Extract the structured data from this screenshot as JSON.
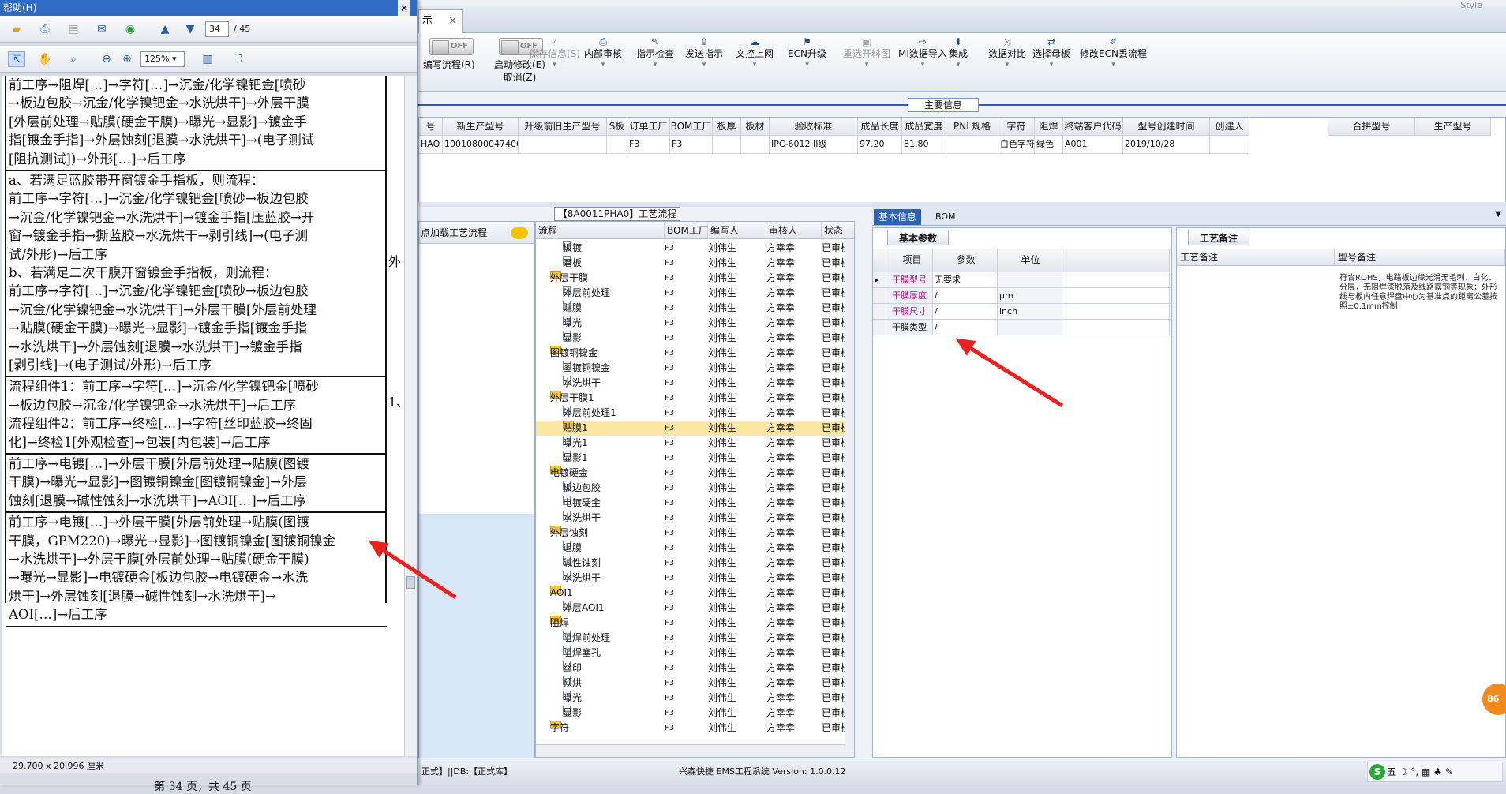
{
  "pdf": {
    "title": "帮助(H)",
    "close": "×",
    "page_current": "34",
    "page_total": "/ 45",
    "zoom": "125%",
    "size": "29.700 x 20.996 厘米",
    "footer": "第 34 页，共 45 页",
    "cells": [
      {
        "lines": [
          "前工序→阻焊[…]→字符[…]→沉金/化学镍钯金[喷砂",
          "→板边包胶→沉金/化学镍钯金→水洗烘干]→外层干膜",
          "[外层前处理→贴膜(硬金干膜)→曝光→显影]→镀金手",
          "指[镀金手指]→外层蚀刻[退膜→水洗烘干]→(电子测试",
          "[阻抗测试])→外形[…]→后工序"
        ]
      },
      {
        "lines": [
          "a、若满足蓝胶带开窗镀金手指板，则流程：",
          "前工序→字符[…]→沉金/化学镍钯金[喷砂→板边包胶",
          "→沉金/化学镍钯金→水洗烘干]→镀金手指[压蓝胶→开",
          "窗→镀金手指→撕蓝胶→水洗烘干→剥引线]→(电子测",
          "试/外形)→后工序",
          "b、若满足二次干膜开窗镀金手指板，则流程：",
          "前工序→字符[…]→沉金/化学镍钯金[喷砂→板边包胶",
          "→沉金/化学镍钯金→水洗烘干]→外层干膜[外层前处理",
          "→贴膜(硬金干膜)→曝光→显影]→镀金手指[镀金手指",
          "→水洗烘干]→外层蚀刻[退膜→水洗烘干]→镀金手指",
          "[剥引线]→(电子测试/外形)→后工序"
        ]
      },
      {
        "lines": [
          "流程组件1：前工序→字符[…]→沉金/化学镍钯金[喷砂",
          "→板边包胶→沉金/化学镍钯金→水洗烘干]→后工序",
          "流程组件2：前工序→终检[…]→字符[丝印蓝胶→终固",
          "化]→终检1[外观检查]→包装[内包装]→后工序"
        ]
      },
      {
        "lines": [
          "前工序→电镀[…]→外层干膜[外层前处理→贴膜(图镀",
          "干膜)→曝光→显影]→图镀铜镍金[图镀铜镍金]→外层",
          "蚀刻[退膜→碱性蚀刻→水洗烘干]→AOI[…]→后工序"
        ]
      },
      {
        "lines": [
          "前工序→电镀[…]→外层干膜[外层前处理→贴膜(图镀",
          "干膜，GPM220)→曝光→显影]→图镀铜镍金[图镀铜镍金",
          "→水洗烘干]→外层干膜[外层前处理→贴膜(硬金干膜)",
          "→曝光→显影]→电镀硬金[板边包胶→电镀硬金→水洗",
          "烘干]→外层蚀刻[退膜→碱性蚀刻→水洗烘干]→",
          "AOI[…]→后工序"
        ]
      }
    ],
    "side_marks": [
      "外",
      "1、"
    ]
  },
  "app": {
    "tab_label": "示",
    "tab_close": "×",
    "style_label": "Style",
    "toggles": [
      {
        "state": "OFF",
        "label": "编写流程(R)"
      },
      {
        "state": "OFF",
        "label": "启动修改(E)",
        "label2": "取消(Z)"
      }
    ],
    "ribbon": [
      {
        "icon": "✓",
        "label": "保存信息(S)",
        "disabled": true
      },
      {
        "icon": "⎙",
        "label": "内部审核"
      },
      {
        "icon": "✎",
        "label": "指示检查"
      },
      {
        "icon": "⇪",
        "label": "发送指示"
      },
      {
        "icon": "☁",
        "label": "文控上网"
      },
      {
        "icon": "⚑",
        "label": "ECN升级"
      },
      {
        "icon": "▣",
        "label": "重选开料图",
        "disabled": true
      },
      {
        "icon": "⇨",
        "label": "MI数据导入"
      },
      {
        "icon": "⬇",
        "label": "集成"
      },
      {
        "icon": "⤨",
        "label": "数据对比"
      },
      {
        "icon": "⇄",
        "label": "选择母板"
      },
      {
        "icon": "✐",
        "label": "修改ECN丢流程"
      }
    ],
    "section_title": "主要信息",
    "main_headers": [
      "号",
      "新生产型号",
      "升级前旧生产型号",
      "S板",
      "订单工厂",
      "BOM工厂",
      "板厚",
      "板材",
      "验收标准",
      "成品长度",
      "成品宽度",
      "PNL规格",
      "字符",
      "阻焊",
      "终端客户代码",
      "型号创建时间",
      "创建人"
    ],
    "main_row": [
      "HAO",
      "10010800047406",
      "",
      "",
      "F3",
      "F3",
      "",
      "",
      "IPC-6012 II级",
      "97.20",
      "81.80",
      "",
      "白色字符",
      "绿色",
      "A001",
      "2019/10/28",
      ""
    ],
    "side_headers": [
      "合拼型号",
      "生产型号"
    ],
    "flow_title": "【8A0011PHA0】工艺流程",
    "left_header": "点加载工艺流程",
    "flow_headers": [
      "流程",
      "BOM工厂",
      "编写人",
      "审核人",
      "状态"
    ],
    "flow_rows": [
      {
        "level": 2,
        "type": "doc",
        "name": "板镀",
        "bom": "F3",
        "editor": "刘伟生",
        "reviewer": "方幸幸",
        "status": "已审核"
      },
      {
        "level": 2,
        "type": "doc",
        "name": "磨板",
        "bom": "F3",
        "editor": "刘伟生",
        "reviewer": "方幸幸",
        "status": "已审核"
      },
      {
        "level": 1,
        "type": "folder",
        "name": "外层干膜",
        "bom": "F3",
        "editor": "刘伟生",
        "reviewer": "方幸幸",
        "status": "已审核"
      },
      {
        "level": 2,
        "type": "doc",
        "name": "外层前处理",
        "bom": "F3",
        "editor": "刘伟生",
        "reviewer": "方幸幸",
        "status": "已审核"
      },
      {
        "level": 2,
        "type": "doc",
        "name": "贴膜",
        "bom": "F3",
        "editor": "刘伟生",
        "reviewer": "方幸幸",
        "status": "已审核"
      },
      {
        "level": 2,
        "type": "doc",
        "name": "曝光",
        "bom": "F3",
        "editor": "刘伟生",
        "reviewer": "方幸幸",
        "status": "已审核"
      },
      {
        "level": 2,
        "type": "doc",
        "name": "显影",
        "bom": "F3",
        "editor": "刘伟生",
        "reviewer": "方幸幸",
        "status": "已审核"
      },
      {
        "level": 1,
        "type": "folder",
        "name": "图镀铜镍金",
        "bom": "F3",
        "editor": "刘伟生",
        "reviewer": "方幸幸",
        "status": "已审核"
      },
      {
        "level": 2,
        "type": "doc",
        "name": "图镀铜镍金",
        "bom": "F3",
        "editor": "刘伟生",
        "reviewer": "方幸幸",
        "status": "已审核"
      },
      {
        "level": 2,
        "type": "doc",
        "name": "水洗烘干",
        "bom": "F3",
        "editor": "刘伟生",
        "reviewer": "方幸幸",
        "status": "已审核"
      },
      {
        "level": 1,
        "type": "folder",
        "name": "外层干膜1",
        "bom": "F3",
        "editor": "刘伟生",
        "reviewer": "方幸幸",
        "status": "已审核"
      },
      {
        "level": 2,
        "type": "doc",
        "name": "外层前处理1",
        "bom": "F3",
        "editor": "刘伟生",
        "reviewer": "方幸幸",
        "status": "已审核"
      },
      {
        "level": 2,
        "type": "folder",
        "name": "贴膜1",
        "bom": "F3",
        "editor": "刘伟生",
        "reviewer": "方幸幸",
        "status": "已审核",
        "selected": true
      },
      {
        "level": 2,
        "type": "doc",
        "name": "曝光1",
        "bom": "F3",
        "editor": "刘伟生",
        "reviewer": "方幸幸",
        "status": "已审核"
      },
      {
        "level": 2,
        "type": "doc",
        "name": "显影1",
        "bom": "F3",
        "editor": "刘伟生",
        "reviewer": "方幸幸",
        "status": "已审核"
      },
      {
        "level": 1,
        "type": "folder",
        "name": "电镀硬金",
        "bom": "F3",
        "editor": "刘伟生",
        "reviewer": "方幸幸",
        "status": "已审核"
      },
      {
        "level": 2,
        "type": "doc",
        "name": "板边包胶",
        "bom": "F3",
        "editor": "刘伟生",
        "reviewer": "方幸幸",
        "status": "已审核"
      },
      {
        "level": 2,
        "type": "doc",
        "name": "电镀硬金",
        "bom": "F3",
        "editor": "刘伟生",
        "reviewer": "方幸幸",
        "status": "已审核"
      },
      {
        "level": 2,
        "type": "doc",
        "name": "水洗烘干",
        "bom": "F3",
        "editor": "刘伟生",
        "reviewer": "方幸幸",
        "status": "已审核"
      },
      {
        "level": 1,
        "type": "folder",
        "name": "外层蚀刻",
        "bom": "F3",
        "editor": "刘伟生",
        "reviewer": "方幸幸",
        "status": "已审核"
      },
      {
        "level": 2,
        "type": "doc",
        "name": "退膜",
        "bom": "F3",
        "editor": "刘伟生",
        "reviewer": "方幸幸",
        "status": "已审核"
      },
      {
        "level": 2,
        "type": "doc",
        "name": "碱性蚀刻",
        "bom": "F3",
        "editor": "刘伟生",
        "reviewer": "方幸幸",
        "status": "已审核"
      },
      {
        "level": 2,
        "type": "doc",
        "name": "水洗烘干",
        "bom": "F3",
        "editor": "刘伟生",
        "reviewer": "方幸幸",
        "status": "已审核"
      },
      {
        "level": 1,
        "type": "folder",
        "name": "AOI1",
        "bom": "F3",
        "editor": "刘伟生",
        "reviewer": "方幸幸",
        "status": "已审核"
      },
      {
        "level": 2,
        "type": "doc",
        "name": "外层AOI1",
        "bom": "F3",
        "editor": "刘伟生",
        "reviewer": "方幸幸",
        "status": "已审核"
      },
      {
        "level": 1,
        "type": "folder",
        "name": "阻焊",
        "bom": "F3",
        "editor": "刘伟生",
        "reviewer": "方幸幸",
        "status": "已审核"
      },
      {
        "level": 2,
        "type": "doc",
        "name": "阻焊前处理",
        "bom": "F3",
        "editor": "刘伟生",
        "reviewer": "方幸幸",
        "status": "已审核"
      },
      {
        "level": 2,
        "type": "doc",
        "name": "阻焊塞孔",
        "bom": "F3",
        "editor": "刘伟生",
        "reviewer": "方幸幸",
        "status": "已审核"
      },
      {
        "level": 2,
        "type": "doc",
        "name": "丝印",
        "bom": "F3",
        "editor": "刘伟生",
        "reviewer": "方幸幸",
        "status": "已审核"
      },
      {
        "level": 2,
        "type": "doc",
        "name": "预烘",
        "bom": "F3",
        "editor": "刘伟生",
        "reviewer": "方幸幸",
        "status": "已审核"
      },
      {
        "level": 2,
        "type": "doc",
        "name": "曝光",
        "bom": "F3",
        "editor": "刘伟生",
        "reviewer": "方幸幸",
        "status": "已审核"
      },
      {
        "level": 2,
        "type": "doc",
        "name": "显影",
        "bom": "F3",
        "editor": "刘伟生",
        "reviewer": "方幸幸",
        "status": "已审核"
      },
      {
        "level": 1,
        "type": "folder",
        "name": "字符",
        "bom": "F3",
        "editor": "刘伟生",
        "reviewer": "方幸幸",
        "status": "已审核"
      }
    ],
    "right_tabs": [
      "基本信息",
      "BOM"
    ],
    "param_tab": "基本参数",
    "param_headers": [
      "项目",
      "参数",
      "单位"
    ],
    "params": [
      {
        "name": "干膜型号",
        "value": "无要求",
        "unit": "",
        "pink": true,
        "current": true
      },
      {
        "name": "干膜厚度",
        "value": "/",
        "unit": "μm",
        "pink": true
      },
      {
        "name": "干膜尺寸",
        "value": "/",
        "unit": "inch",
        "pink": true
      },
      {
        "name": "干膜类型",
        "value": "/",
        "unit": "",
        "pink": false
      }
    ],
    "note_tab": "工艺备注",
    "note_headers": [
      "工艺备注",
      "型号备注"
    ],
    "note_text": "符合ROHS，电路板边缘光滑无毛刺、白化、分层，无阻焊漆脱落及线路露铜等现象；外形线与板内任意焊盘中心为基准点的距离公差按照±0.1mm控制",
    "status_left": "正式】||DB:【正式库】",
    "status_center": "兴森快捷 EMS工程系统 Version: 1.0.0.12",
    "ime": "五 ☽ °, ▦ ♣ ✎",
    "badge": "86"
  }
}
